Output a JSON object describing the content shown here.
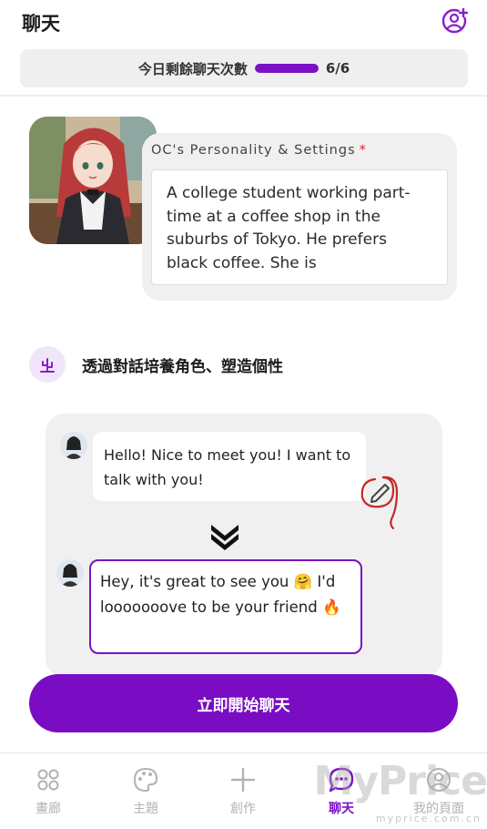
{
  "header": {
    "title": "聊天",
    "add_friend_icon": "user-plus-icon"
  },
  "quota": {
    "label": "今日剩餘聊天次數",
    "remaining_fraction": 1.0,
    "count": "6/6",
    "bar_color": "#7a12c4"
  },
  "character": {
    "avatar_icon": "anime-maid-portrait",
    "settings_title": "OC's Personality & Settings",
    "required_mark": "*",
    "description": "A college student working part-time at a coffee shop in the suburbs of Tokyo. He prefers black coffee. She is"
  },
  "feature": {
    "icon": "cactus-icon",
    "text": "透過對話培養角色、塑造個性"
  },
  "demo": {
    "user_message": "Hello! Nice to meet you! I want to talk with you!",
    "edit_icon": "pencil-icon",
    "arrow_icon": "double-chevron-down-icon",
    "reply_message": "Hey, it's great to see you 🤗 I'd looooooove to be your friend 🔥"
  },
  "cta": {
    "label": "立即開始聊天"
  },
  "nav": {
    "items": [
      {
        "label": "畫廊",
        "icon": "gallery-icon",
        "active": false
      },
      {
        "label": "主題",
        "icon": "palette-icon",
        "active": false
      },
      {
        "label": "創作",
        "icon": "plus-icon",
        "active": false
      },
      {
        "label": "聊天",
        "icon": "chat-icon",
        "active": true
      },
      {
        "label": "我的頁面",
        "icon": "profile-icon",
        "active": false
      }
    ]
  },
  "watermark": {
    "text": "MyPrice",
    "sub": "myprice.com.cn"
  },
  "colors": {
    "accent": "#7a12c4",
    "cta": "#7a0cc4",
    "annotation": "#c62828"
  }
}
